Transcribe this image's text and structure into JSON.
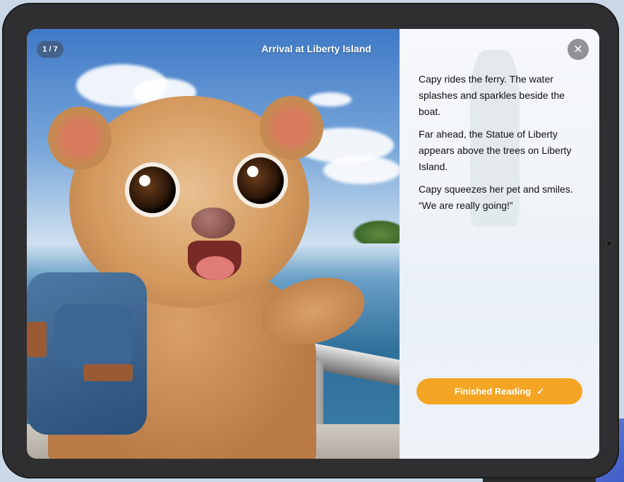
{
  "book": {
    "page_indicator": "1 / 7",
    "page_title": "Arrival at Liberty Island"
  },
  "story": {
    "paragraphs": [
      "Capy rides the ferry. The water splashes and sparkles beside the boat.",
      "Far ahead, the Statue of Liberty appears above the trees on Liberty Island.",
      "Capy squeezes her pet and smiles. “We are really going!”"
    ]
  },
  "actions": {
    "finish_label": "Finished Reading",
    "finish_icon": "checkmark-icon",
    "close_icon": "close-icon"
  },
  "colors": {
    "accent": "#f4a524",
    "close_button": "#8f9396",
    "bezel": "#2f2f31"
  }
}
